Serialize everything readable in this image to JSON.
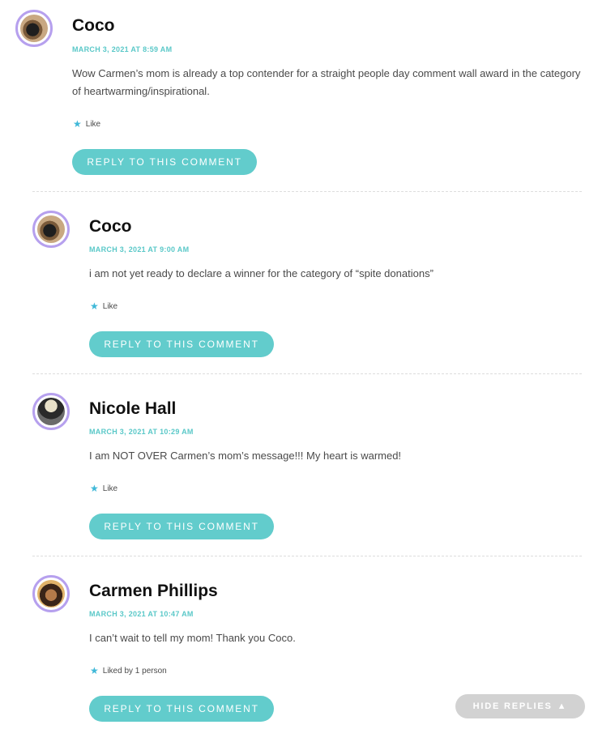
{
  "comments": [
    {
      "author": "Coco",
      "date": "MARCH 3, 2021 AT 8:59 AM",
      "text": "Wow Carmen’s mom is already a top contender for a straight people day comment wall award in the category of heartwarming/inspirational.",
      "like": "Like",
      "reply": "REPLY TO THIS COMMENT"
    },
    {
      "author": "Coco",
      "date": "MARCH 3, 2021 AT 9:00 AM",
      "text": "i am not yet ready to declare a winner for the category of “spite donations”",
      "like": "Like",
      "reply": "REPLY TO THIS COMMENT"
    },
    {
      "author": "Nicole Hall",
      "date": "MARCH 3, 2021 AT 10:29 AM",
      "text": "I am NOT OVER Carmen’s mom’s message!!! My heart is warmed!",
      "like": "Like",
      "reply": "REPLY TO THIS COMMENT"
    },
    {
      "author": "Carmen Phillips",
      "date": "MARCH 3, 2021 AT 10:47 AM",
      "text": "I can’t wait to tell my mom! Thank you Coco.",
      "like": "Liked by 1 person",
      "reply": "REPLY TO THIS COMMENT"
    }
  ],
  "hide_replies": "HIDE REPLIES",
  "hide_replies_arrow": "▲",
  "icons": {
    "like": "star-icon",
    "hide": "triangle-up-icon"
  },
  "colors": {
    "accent": "#62cccc",
    "avatar_ring": "#b6a0ee",
    "date": "#5ac8c8",
    "hide_button": "#d2d2d2"
  }
}
